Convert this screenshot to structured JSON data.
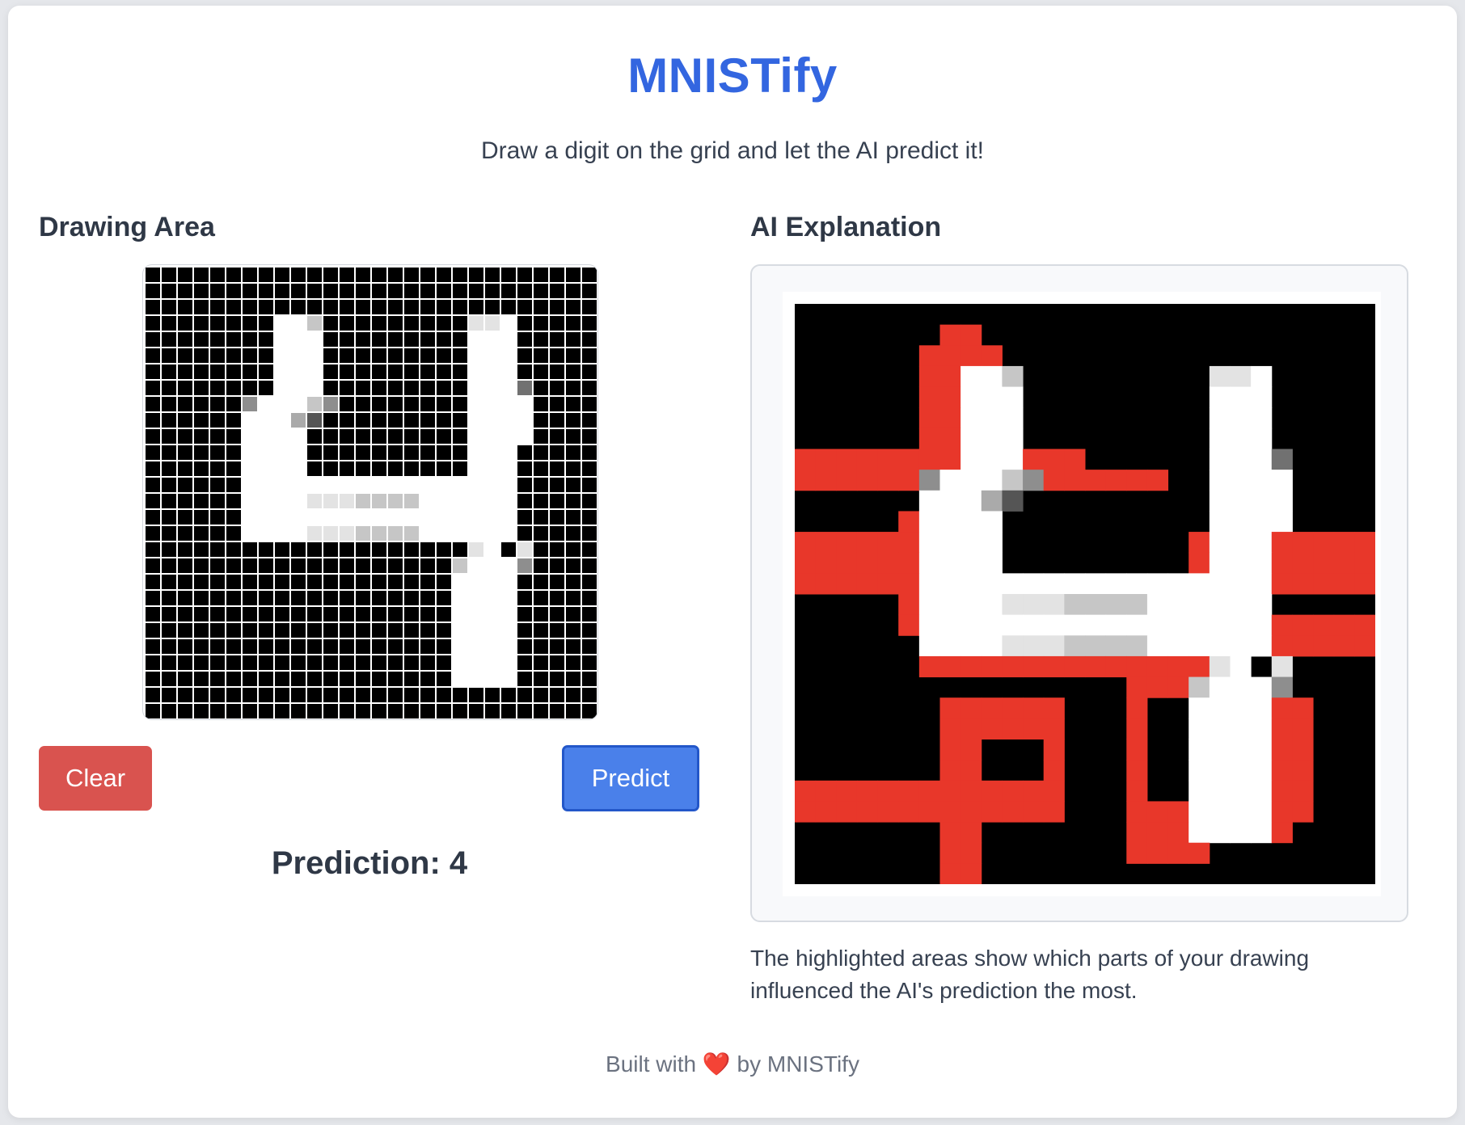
{
  "app": {
    "title": "MNISTify",
    "subtitle": "Draw a digit on the grid and let the AI predict it!"
  },
  "drawing_area": {
    "heading": "Drawing Area",
    "grid_size": 28,
    "clear_label": "Clear",
    "predict_label": "Predict",
    "prediction_label": "Prediction: 4",
    "pixels": [
      "0000000000000000000000000000",
      "0000000000000000000000000000",
      "0000000000000000000000000000",
      "0000000099700000000088900000",
      "0000000099900000000099900000",
      "0000000099900000000099900000",
      "0000000099900000000099900000",
      "0000000099900000000099940000",
      "0000005999750000000099990000",
      "0000009996300000000099990000",
      "0000009999000000000099990000",
      "0000009999000000000099900000",
      "0000009999000000000099900000",
      "0000009999999999999999900000",
      "0000009999888777799999900000",
      "0000009999999999999999900000",
      "0000009999888777799999900000",
      "0000000000000000000089080000",
      "0000000000000000000799950000",
      "0000000000000000000999900000",
      "0000000000000000000999900000",
      "0000000000000000000999900000",
      "0000000000000000000999900000",
      "0000000000000000000999900000",
      "0000000000000000000999900000",
      "0000000000000000000999900000",
      "0000000000000000000000000000",
      "0000000000000000000000000000"
    ]
  },
  "explanation": {
    "heading": "AI Explanation",
    "description": "The highlighted areas show which parts of your drawing influenced the AI's prediction the most.",
    "highlight_color": "#e8372a",
    "grid_size": 28
  },
  "footer": {
    "prefix": "Built with",
    "heart": "❤️",
    "suffix": "by MNISTify"
  }
}
